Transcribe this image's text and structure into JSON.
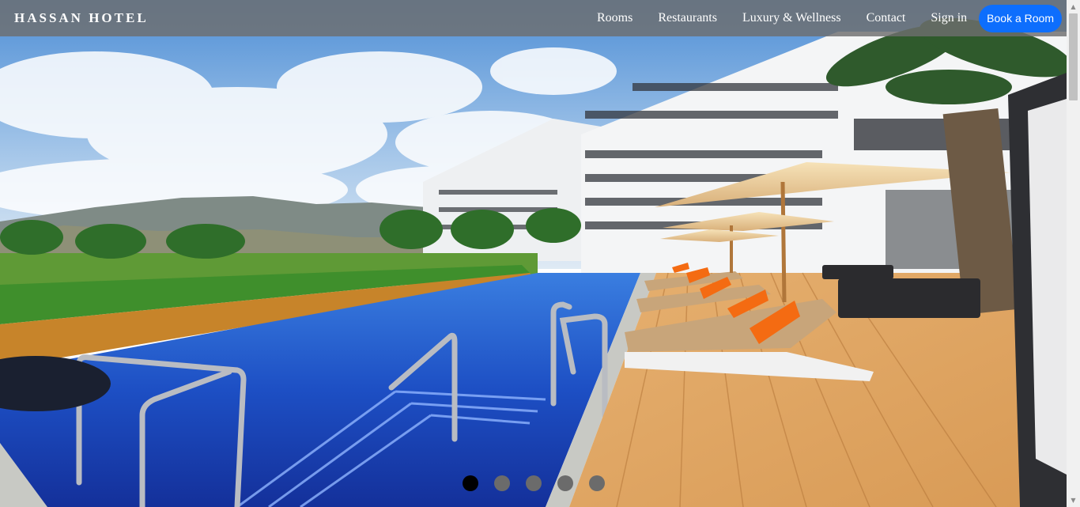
{
  "navbar": {
    "brand": "HASSAN HOTEL",
    "links": [
      "Rooms",
      "Restaurants",
      "Luxury & Wellness",
      "Contact",
      "Sign in"
    ],
    "book_label": "Book a Room"
  },
  "hero": {
    "image_subject": "hotel-pool-photo",
    "slide_count": 5,
    "active_slide": 1
  },
  "colors": {
    "accent": "#0d6efd",
    "navbar_bg": "#6e6e6e",
    "dot_active": "#000000",
    "dot_inactive": "#6b6b6b"
  }
}
